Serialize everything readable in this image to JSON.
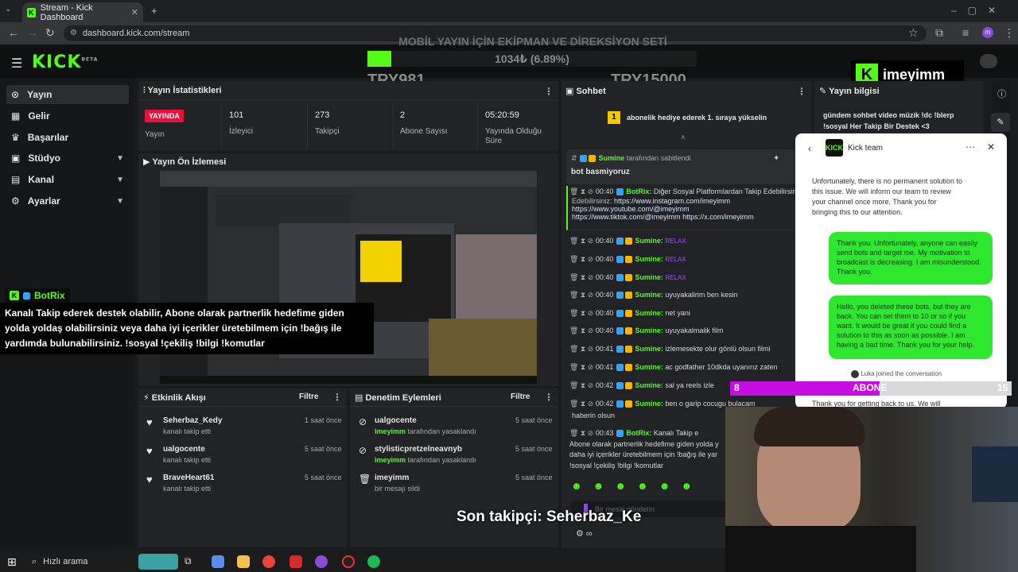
{
  "browser": {
    "tab_title": "Stream - Kick Dashboard",
    "url": "dashboard.kick.com/stream"
  },
  "brand": {
    "logo": "KICK",
    "beta": "BETA",
    "accent": "#53fc18"
  },
  "overlay": {
    "goal_title": "MOBİL YAYIN İÇİN EKİPMAN VE DİREKSİYON SETİ",
    "goal_progress_text": "1034₺ (6.89%)",
    "goal_progress": 0.0689,
    "goal_start": "TRY981",
    "goal_end": "TRY15000",
    "watermark": "imeyimm",
    "botrix_name": "BotRix",
    "botrix_message": "Kanalı Takip ederek destek olabilir, Abone olarak partnerlik hedefime giden yolda yoldaş olabilirsiniz veya daha iyi içerikler üretebilmem için !bağış ile yardımda bulunabilirsiniz. !sosyal !çekiliş !bilgi !komutlar",
    "sub_bar_left": "8",
    "sub_bar_label": "ABONE",
    "sub_bar_right": "15",
    "sub_progress": 0.53,
    "last_follower": "Son takipçi: Seherbaz_Ke"
  },
  "sidebar": {
    "items": [
      {
        "label": "Yayın",
        "icon": "broadcast-icon",
        "active": true
      },
      {
        "label": "Gelir",
        "icon": "revenue-icon"
      },
      {
        "label": "Başarılar",
        "icon": "trophy-icon"
      },
      {
        "label": "Stüdyo",
        "icon": "studio-icon",
        "expand": true
      },
      {
        "label": "Kanal",
        "icon": "channel-icon",
        "expand": true
      },
      {
        "label": "Ayarlar",
        "icon": "settings-icon",
        "expand": true
      }
    ]
  },
  "stats": {
    "title": "Yayın İstatistikleri",
    "live_badge": "YAYINDA",
    "live_label": "Yayın",
    "viewers": "101",
    "viewers_label": "İzleyici",
    "followers": "273",
    "followers_label": "Takipçi",
    "subs": "2",
    "subs_label": "Abone Sayısı",
    "uptime": "05:20:59",
    "uptime_label": "Yayında Olduğu Süre"
  },
  "preview": {
    "title": "Yayın Ön İzlemesi"
  },
  "activity": {
    "title": "Etkinlik Akışı",
    "filter": "Filtre",
    "items": [
      {
        "name": "Seherbaz_Kedy",
        "action": "kanalı takip etti",
        "time": "1 saat önce"
      },
      {
        "name": "ualgocente",
        "action": "kanalı takip etti",
        "time": "5 saat önce"
      },
      {
        "name": "BraveHeart61",
        "action": "kanalı takip etti",
        "time": "5 saat önce"
      }
    ]
  },
  "moderation": {
    "title": "Denetim Eylemleri",
    "filter": "Filtre",
    "items": [
      {
        "name": "ualgocente",
        "actor": "imeyimm",
        "action": "tarafından yasaklandı",
        "time": "5 saat önce"
      },
      {
        "name": "stylisticpretzelneavnyb",
        "actor": "imeyimm",
        "action": "tarafından yasaklandı",
        "time": "5 saat önce"
      },
      {
        "name": "imeyimm",
        "actor": "",
        "action": "bir mesajı sildi",
        "time": "5 saat önce"
      }
    ]
  },
  "chat": {
    "title": "Sohbet",
    "gift_count": "1",
    "gift_text": "abonelik hediye ederek 1. sıraya yükselin",
    "pinned_user": "Sumine",
    "pinned_by": "tarafından sabitlendi",
    "pinned_msg": "bot basmiyoruz",
    "links_intro": "00:40",
    "links_user": "BotRix:",
    "links_text": "Diğer Sosyal Platformlardan Takip Edebilirsiniz:",
    "link1": "https://www.instagram.com/imeyimm",
    "link2": "https://www.youtube.com/@imeyimm",
    "link3": "https://www.tiktok.com/@imeyimm",
    "link4": "https://x.com/imeyimm",
    "messages": [
      {
        "time": "00:40",
        "user": "Sumine:",
        "text": "RELAX",
        "emote": true
      },
      {
        "time": "00:40",
        "user": "Sumine:",
        "text": "RELAX",
        "emote": true
      },
      {
        "time": "00:40",
        "user": "Sumine:",
        "text": "RELAX",
        "emote": true
      },
      {
        "time": "00:40",
        "user": "Sumine:",
        "text": "uyuyakalirim ben kesin"
      },
      {
        "time": "00:40",
        "user": "Sumine:",
        "text": "net yani"
      },
      {
        "time": "00:40",
        "user": "Sumine:",
        "text": "uyuyakalmalik film"
      },
      {
        "time": "00:41",
        "user": "Sumine:",
        "text": "izlemesekte olur gönlü olsun filmi"
      },
      {
        "time": "00:41",
        "user": "Sumine:",
        "text": "ac godfather 10dkda uyanırız zaten"
      },
      {
        "time": "00:42",
        "user": "Sumine:",
        "text": "sal ya reels izle"
      },
      {
        "time": "00:42",
        "user": "Sumine:",
        "text": "ben o garip cocugu bulacam"
      }
    ],
    "continuation": "haberin olsun",
    "bot_time": "00:43",
    "bot_user": "BotRix:",
    "bot_text1": "Kanalı Takip e",
    "bot_text2": "Abone olarak partnerlik hedefime giden yolda y",
    "bot_text3": "daha iyi içerikler üretebilmem için !bağış ile yar",
    "bot_text4": "!sosyal !çekiliş !bilgi !komutlar",
    "input_placeholder": "Bir mesaj gönderin"
  },
  "stream_info": {
    "title": "Yayın bilgisi",
    "text": "gündem sohbet video müzik !dc !blerp !sosyal Her Takip Bir Destek <3"
  },
  "support": {
    "title": "Kick team",
    "agent_msg": "Unfortunately, there is no permanent solution to this issue. We will inform our team to review your channel once more. Thank you for bringing this to our attention.",
    "user_msg1": "Thank you. Unfortunately, anyone can easily send bots and target me. My motivation to broadcast is decreasing. I am misunderstood. Thank you.",
    "user_msg2": "Hello, you deleted these bots, but they are back. You can set them to 10 or so if you want. It would be great if you could find a solution to this as soon as possible. I am having a bad time. Thank you for your help.",
    "joined": "Luka joined the conversation",
    "agent_msg2": "Thank you for getting back to us. We will"
  },
  "taskbar": {
    "search": "Hızlı arama"
  }
}
